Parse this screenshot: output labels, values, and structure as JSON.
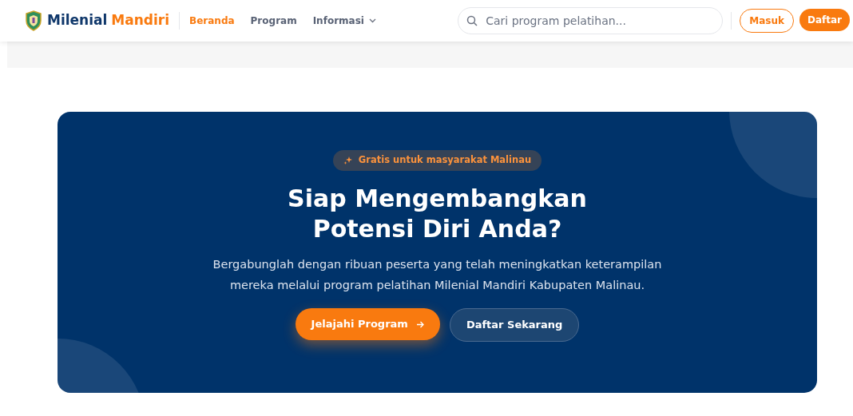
{
  "brand": {
    "first": "Milenial",
    "second": "Mandiri"
  },
  "nav": [
    {
      "label": "Beranda",
      "selected": true,
      "dropdown": false
    },
    {
      "label": "Program",
      "selected": false,
      "dropdown": false
    },
    {
      "label": "Informasi",
      "selected": false,
      "dropdown": true
    }
  ],
  "search": {
    "placeholder": "Cari program pelatihan..."
  },
  "auth_buttons": [
    {
      "label": "Masuk",
      "kind": "outline"
    },
    {
      "label": "Daftar",
      "kind": "solid"
    }
  ],
  "cta": {
    "badge": "Gratis untuk masyarakat Malinau",
    "title_lines": [
      "Siap Mengembangkan",
      "Potensi Diri Anda?"
    ],
    "description": "Bergabunglah dengan ribuan peserta yang telah meningkatkan keterampilan mereka melalui program pelatihan Milenial Mandiri Kabupaten Malinau.",
    "buttons": [
      {
        "label": "Jelajahi Program",
        "kind": "primary",
        "arrow": true
      },
      {
        "label": "Daftar Sekarang",
        "kind": "secondary",
        "arrow": false
      }
    ]
  }
}
